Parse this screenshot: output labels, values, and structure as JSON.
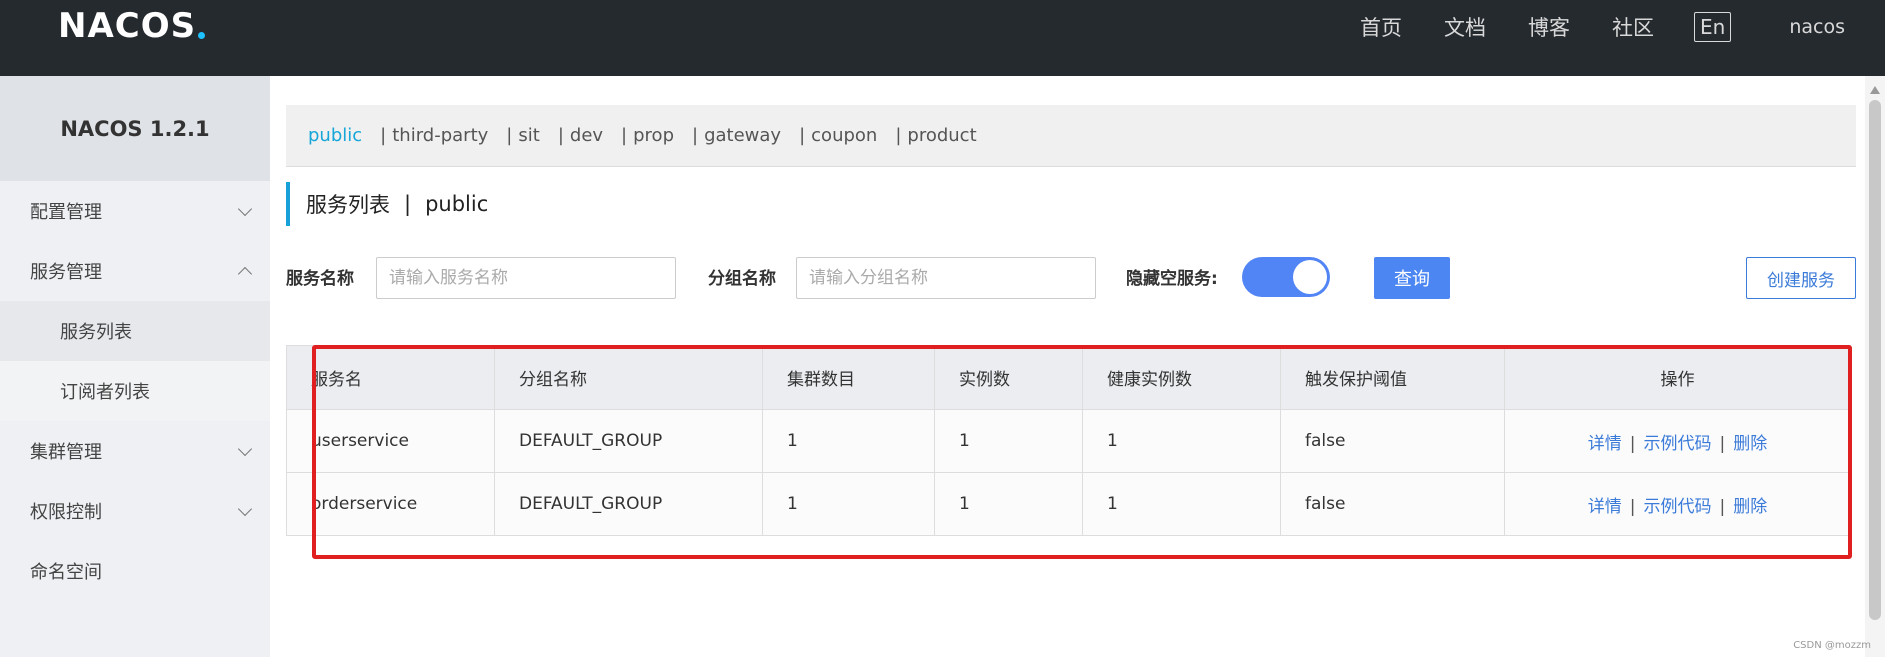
{
  "topbar": {
    "logo": "NACOS",
    "nav": [
      "首页",
      "文档",
      "博客",
      "社区"
    ],
    "lang": "En",
    "user": "nacos"
  },
  "sidebar": {
    "brand": "NACOS 1.2.1",
    "items": [
      {
        "label": "配置管理"
      },
      {
        "label": "服务管理"
      },
      {
        "label": "服务列表"
      },
      {
        "label": "订阅者列表"
      },
      {
        "label": "集群管理"
      },
      {
        "label": "权限控制"
      },
      {
        "label": "命名空间"
      }
    ]
  },
  "namespaces": [
    "public",
    "third-party",
    "sit",
    "dev",
    "prop",
    "gateway",
    "coupon",
    "product"
  ],
  "page": {
    "title": "服务列表",
    "separator": "|",
    "namespace": "public"
  },
  "search": {
    "service_label": "服务名称",
    "service_placeholder": "请输入服务名称",
    "group_label": "分组名称",
    "group_placeholder": "请输入分组名称",
    "hide_empty_label": "隐藏空服务:",
    "query_button": "查询",
    "create_button": "创建服务"
  },
  "table": {
    "headers": [
      "服务名",
      "分组名称",
      "集群数目",
      "实例数",
      "健康实例数",
      "触发保护阈值",
      "操作"
    ],
    "rows": [
      {
        "name": "userservice",
        "group": "DEFAULT_GROUP",
        "clusters": "1",
        "instances": "1",
        "healthy": "1",
        "threshold": "false"
      },
      {
        "name": "orderservice",
        "group": "DEFAULT_GROUP",
        "clusters": "1",
        "instances": "1",
        "healthy": "1",
        "threshold": "false"
      }
    ],
    "actions": {
      "detail": "详情",
      "sample": "示例代码",
      "delete": "删除",
      "sep": "|"
    }
  },
  "watermark": "CSDN @mozzm",
  "colors": {
    "accent": "#4b86f2",
    "topbar": "#252a2f",
    "highlight": "#e02020"
  }
}
